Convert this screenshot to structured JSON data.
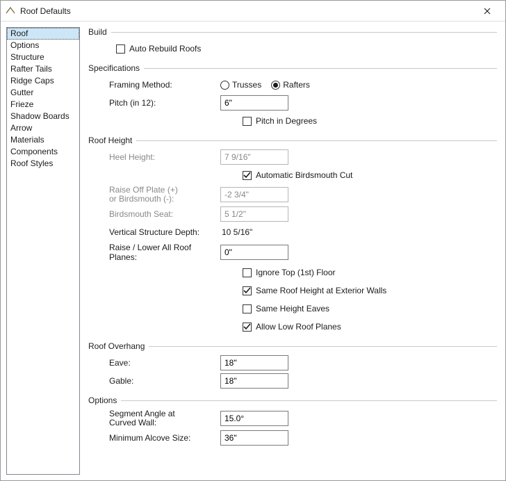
{
  "window": {
    "title": "Roof Defaults"
  },
  "sidebar": {
    "items": [
      {
        "label": "Roof"
      },
      {
        "label": "Options"
      },
      {
        "label": "Structure"
      },
      {
        "label": "Rafter Tails"
      },
      {
        "label": "Ridge Caps"
      },
      {
        "label": "Gutter"
      },
      {
        "label": "Frieze"
      },
      {
        "label": "Shadow Boards"
      },
      {
        "label": "Arrow"
      },
      {
        "label": "Materials"
      },
      {
        "label": "Components"
      },
      {
        "label": "Roof Styles"
      }
    ],
    "selected_index": 0
  },
  "build": {
    "title": "Build",
    "auto_rebuild_label": "Auto Rebuild Roofs",
    "auto_rebuild_checked": false
  },
  "specs": {
    "title": "Specifications",
    "framing_method_label": "Framing Method:",
    "trusses_label": "Trusses",
    "rafters_label": "Rafters",
    "framing_method_value": "rafters",
    "pitch_label": "Pitch (in 12):",
    "pitch_value": "6\"",
    "pitch_in_degrees_label": "Pitch in Degrees",
    "pitch_in_degrees_checked": false
  },
  "roof_height": {
    "title": "Roof Height",
    "heel_height_label": "Heel Height:",
    "heel_height_value": "7 9/16\"",
    "auto_birdsmouth_label": "Automatic Birdsmouth Cut",
    "auto_birdsmouth_checked": true,
    "raise_off_plate_label_1": "Raise Off Plate (+)",
    "raise_off_plate_label_2": "or Birdsmouth (-):",
    "raise_off_plate_value": "-2 3/4\"",
    "birdsmouth_seat_label": "Birdsmouth Seat:",
    "birdsmouth_seat_value": "5 1/2\"",
    "vertical_depth_label": "Vertical Structure Depth:",
    "vertical_depth_value": "10 5/16\"",
    "raise_lower_label": "Raise / Lower All Roof Planes:",
    "raise_lower_value": "0\"",
    "ignore_top_label": "Ignore Top (1st) Floor",
    "ignore_top_checked": false,
    "same_height_ext_label": "Same Roof Height at Exterior Walls",
    "same_height_ext_checked": true,
    "same_height_eaves_label": "Same Height Eaves",
    "same_height_eaves_checked": false,
    "allow_low_label": "Allow Low Roof Planes",
    "allow_low_checked": true
  },
  "overhang": {
    "title": "Roof Overhang",
    "eave_label": "Eave:",
    "eave_value": "18\"",
    "gable_label": "Gable:",
    "gable_value": "18\""
  },
  "options": {
    "title": "Options",
    "segment_angle_label_1": "Segment Angle at",
    "segment_angle_label_2": "Curved Wall:",
    "segment_angle_value": "15.0°",
    "min_alcove_label": "Minimum Alcove Size:",
    "min_alcove_value": "36\""
  }
}
